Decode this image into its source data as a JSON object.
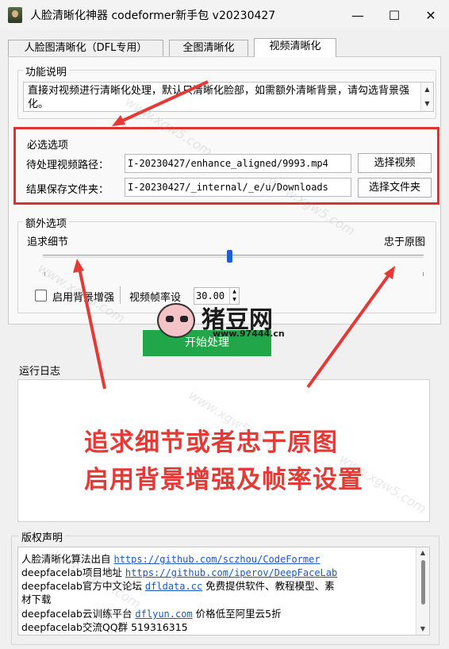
{
  "window": {
    "title": "人脸清晰化神器 codeformer新手包 v20230427",
    "minimize_glyph": "—",
    "maximize_glyph": "☐",
    "close_glyph": "✕"
  },
  "tabs": [
    {
      "label": "人脸图清晰化（DFL专用）",
      "active": false
    },
    {
      "label": "全图清晰化",
      "active": false
    },
    {
      "label": "视频清晰化",
      "active": true
    }
  ],
  "function_desc": {
    "title": "功能说明",
    "text": "直接对视频进行清晰化处理，默认只清晰化脸部，如需额外清晰背景，请勾选背景强化。"
  },
  "required": {
    "title": "必选选项",
    "video_path_label": "待处理视频路径：",
    "video_path_value": "I-20230427/enhance_aligned/9993.mp4",
    "select_video_button": "选择视频",
    "output_folder_label": "结果保存文件夹：",
    "output_folder_value": "I-20230427/_internal/_e/u/Downloads",
    "select_folder_button": "选择文件夹"
  },
  "extra": {
    "title": "额外选项",
    "slider_left_label": "追求细节",
    "slider_right_label": "忠于原图",
    "slider_value_fraction": 0.49,
    "bg_enhance_label": "启用背景增强",
    "bg_enhance_checked": false,
    "fps_label": "视频帧率设",
    "fps_value": "30.00"
  },
  "start_button": "开始处理",
  "log": {
    "title": "运行日志"
  },
  "overlay_annotation": {
    "line1": "追求细节或者忠于原图",
    "line2": "启用背景增强及帧率设置",
    "color": "#e53935"
  },
  "copyright": {
    "title": "版权声明",
    "lines": [
      {
        "prefix": "人脸清晰化算法出自 ",
        "link": "https://github.com/sczhou/CodeFormer",
        "suffix": ""
      },
      {
        "prefix": "deepfacelab项目地址 ",
        "link": "https://github.com/iperov/DeepFaceLab",
        "suffix": ""
      },
      {
        "prefix": "deepfacelab官方中文论坛  ",
        "link": "dfldata.cc",
        "suffix": "  免费提供软件、教程模型、素"
      },
      {
        "prefix": "材下载",
        "link": "",
        "suffix": ""
      },
      {
        "prefix": "deepfacelab云训练平台 ",
        "link": "dflyun.com",
        "suffix": "  价格低至阿里云5折"
      },
      {
        "prefix": "deepfacelab交流QQ群 519316315",
        "link": "",
        "suffix": ""
      }
    ]
  },
  "watermark": {
    "logo_text": "猪豆网",
    "logo_url": "www.97444.cn",
    "tile_text": "www.xgw5.com"
  },
  "colors": {
    "accent_red": "#e03131",
    "start_green": "#21a64a",
    "link_blue": "#1a57c9",
    "slider_blue": "#1f5fd6"
  }
}
